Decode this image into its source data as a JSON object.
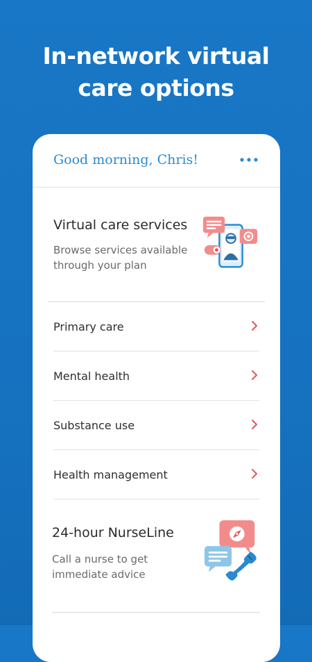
{
  "promo": {
    "title_line1": "In-network virtual",
    "title_line2": "care options"
  },
  "header": {
    "greeting": "Good morning, Chris!",
    "menu_icon": "more-horizontal-icon"
  },
  "virtual_care": {
    "title": "Virtual care services",
    "description": "Browse services available through your plan",
    "illustration": "telehealth-phone-illustration"
  },
  "menu": {
    "items": [
      {
        "label": "Primary care"
      },
      {
        "label": "Mental health"
      },
      {
        "label": "Substance use"
      },
      {
        "label": "Health management"
      }
    ]
  },
  "nurseline": {
    "title": "24-hour NurseLine",
    "description": "Call a nurse to get immediate advice",
    "illustration": "nurse-call-illustration"
  },
  "colors": {
    "background": "#1672c0",
    "accent_blue": "#2a8ad0",
    "chevron_red": "#e0565a",
    "illustration_pink": "#f28c8c",
    "illustration_blue": "#8ec6e8"
  }
}
